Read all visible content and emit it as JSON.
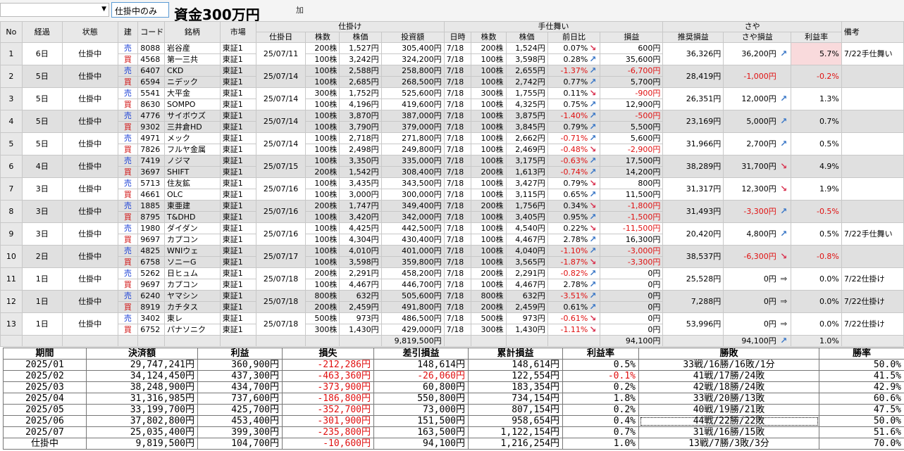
{
  "toolbar": {
    "filter_value": "仕掛中のみ",
    "capital_label": "資金300万円",
    "extra": "加"
  },
  "grid": {
    "header_groups": {
      "entry": "仕掛け",
      "exit": "手仕舞い",
      "spread": "さや",
      "note": "備考"
    },
    "headers": {
      "no": "No",
      "elapsed": "経過",
      "status": "状態",
      "side": "建",
      "code": "コード",
      "name": "銘柄",
      "market": "市場",
      "entry_date": "仕掛日",
      "entry_shares": "株数",
      "entry_price": "株価",
      "entry_amount": "投資額",
      "exit_date": "日時",
      "exit_shares": "株数",
      "exit_price": "株価",
      "exit_change": "前日比",
      "exit_pl": "損益",
      "rec_pl": "推奨損益",
      "spread_pl": "さや損益",
      "rate": "利益率"
    },
    "rows": [
      {
        "no": "1",
        "elapsed": "6日",
        "status": "仕掛中",
        "date": "25/07/11",
        "rec": "36,326円",
        "spread": "36,200円",
        "trend": "up",
        "rate": "5.7%",
        "note": "7/22手仕舞い",
        "pink": true,
        "legs": [
          {
            "side": "売",
            "code": "8088",
            "name": "岩谷産",
            "market": "東証1",
            "shares": "200株",
            "price": "1,527円",
            "amount": "305,400円",
            "xdate": "7/18",
            "xshares": "200株",
            "xprice": "1,524円",
            "chg": "0.07%",
            "chgdir": "down",
            "pl": "600円"
          },
          {
            "side": "買",
            "code": "4568",
            "name": "第一三共",
            "market": "東証1",
            "shares": "100株",
            "price": "3,242円",
            "amount": "324,200円",
            "xdate": "7/18",
            "xshares": "100株",
            "xprice": "3,598円",
            "chg": "0.28%",
            "chgdir": "up",
            "pl": "35,600円"
          }
        ]
      },
      {
        "no": "2",
        "elapsed": "5日",
        "status": "仕掛中",
        "date": "25/07/14",
        "rec": "28,419円",
        "spread": "-1,000円",
        "trend": "",
        "rate": "-0.2%",
        "note": "",
        "pink": false,
        "legs": [
          {
            "side": "売",
            "code": "6407",
            "name": "CKD",
            "market": "東証1",
            "shares": "100株",
            "price": "2,588円",
            "amount": "258,800円",
            "xdate": "7/18",
            "xshares": "100株",
            "xprice": "2,655円",
            "chg": "-1.37%",
            "chgdir": "up",
            "pl": "-6,700円"
          },
          {
            "side": "買",
            "code": "6594",
            "name": "ニデック",
            "market": "東証1",
            "shares": "100株",
            "price": "2,685円",
            "amount": "268,500円",
            "xdate": "7/18",
            "xshares": "100株",
            "xprice": "2,742円",
            "chg": "0.77%",
            "chgdir": "up",
            "pl": "5,700円"
          }
        ]
      },
      {
        "no": "3",
        "elapsed": "5日",
        "status": "仕掛中",
        "date": "25/07/14",
        "rec": "26,351円",
        "spread": "12,000円",
        "trend": "up",
        "rate": "1.3%",
        "note": "",
        "pink": false,
        "legs": [
          {
            "side": "売",
            "code": "5541",
            "name": "大平金",
            "market": "東証1",
            "shares": "300株",
            "price": "1,752円",
            "amount": "525,600円",
            "xdate": "7/18",
            "xshares": "300株",
            "xprice": "1,755円",
            "chg": "0.11%",
            "chgdir": "down",
            "pl": "-900円"
          },
          {
            "side": "買",
            "code": "8630",
            "name": "SOMPO",
            "market": "東証1",
            "shares": "100株",
            "price": "4,196円",
            "amount": "419,600円",
            "xdate": "7/18",
            "xshares": "100株",
            "xprice": "4,325円",
            "chg": "0.75%",
            "chgdir": "up",
            "pl": "12,900円"
          }
        ]
      },
      {
        "no": "4",
        "elapsed": "5日",
        "status": "仕掛中",
        "date": "25/07/14",
        "rec": "23,169円",
        "spread": "5,000円",
        "trend": "up",
        "rate": "0.7%",
        "note": "",
        "pink": false,
        "legs": [
          {
            "side": "売",
            "code": "4776",
            "name": "サイボウズ",
            "market": "東証1",
            "shares": "100株",
            "price": "3,870円",
            "amount": "387,000円",
            "xdate": "7/18",
            "xshares": "100株",
            "xprice": "3,875円",
            "chg": "-1.40%",
            "chgdir": "up",
            "pl": "-500円"
          },
          {
            "side": "買",
            "code": "9302",
            "name": "三井倉HD",
            "market": "東証1",
            "shares": "100株",
            "price": "3,790円",
            "amount": "379,000円",
            "xdate": "7/18",
            "xshares": "100株",
            "xprice": "3,845円",
            "chg": "0.79%",
            "chgdir": "up",
            "pl": "5,500円"
          }
        ]
      },
      {
        "no": "5",
        "elapsed": "5日",
        "status": "仕掛中",
        "date": "25/07/14",
        "rec": "31,966円",
        "spread": "2,700円",
        "trend": "up",
        "rate": "0.5%",
        "note": "",
        "pink": false,
        "legs": [
          {
            "side": "売",
            "code": "4971",
            "name": "メック",
            "market": "東証1",
            "shares": "100株",
            "price": "2,718円",
            "amount": "271,800円",
            "xdate": "7/18",
            "xshares": "100株",
            "xprice": "2,662円",
            "chg": "-0.71%",
            "chgdir": "up",
            "pl": "5,600円"
          },
          {
            "side": "買",
            "code": "7826",
            "name": "フルヤ金属",
            "market": "東証1",
            "shares": "100株",
            "price": "2,498円",
            "amount": "249,800円",
            "xdate": "7/18",
            "xshares": "100株",
            "xprice": "2,469円",
            "chg": "-0.48%",
            "chgdir": "down",
            "pl": "-2,900円"
          }
        ]
      },
      {
        "no": "6",
        "elapsed": "4日",
        "status": "仕掛中",
        "date": "25/07/15",
        "rec": "38,289円",
        "spread": "31,700円",
        "trend": "down",
        "rate": "4.9%",
        "note": "",
        "pink": false,
        "legs": [
          {
            "side": "売",
            "code": "7419",
            "name": "ノジマ",
            "market": "東証1",
            "shares": "100株",
            "price": "3,350円",
            "amount": "335,000円",
            "xdate": "7/18",
            "xshares": "100株",
            "xprice": "3,175円",
            "chg": "-0.63%",
            "chgdir": "up",
            "pl": "17,500円"
          },
          {
            "side": "買",
            "code": "3697",
            "name": "SHIFT",
            "market": "東証1",
            "shares": "200株",
            "price": "1,542円",
            "amount": "308,400円",
            "xdate": "7/18",
            "xshares": "200株",
            "xprice": "1,613円",
            "chg": "-0.74%",
            "chgdir": "up",
            "pl": "14,200円"
          }
        ]
      },
      {
        "no": "7",
        "elapsed": "3日",
        "status": "仕掛中",
        "date": "25/07/16",
        "rec": "31,317円",
        "spread": "12,300円",
        "trend": "down",
        "rate": "1.9%",
        "note": "",
        "pink": false,
        "legs": [
          {
            "side": "売",
            "code": "5713",
            "name": "住友鉱",
            "market": "東証1",
            "shares": "100株",
            "price": "3,435円",
            "amount": "343,500円",
            "xdate": "7/18",
            "xshares": "100株",
            "xprice": "3,427円",
            "chg": "0.79%",
            "chgdir": "down",
            "pl": "800円"
          },
          {
            "side": "買",
            "code": "4661",
            "name": "OLC",
            "market": "東証1",
            "shares": "100株",
            "price": "3,000円",
            "amount": "300,000円",
            "xdate": "7/18",
            "xshares": "100株",
            "xprice": "3,115円",
            "chg": "0.65%",
            "chgdir": "up",
            "pl": "11,500円"
          }
        ]
      },
      {
        "no": "8",
        "elapsed": "3日",
        "status": "仕掛中",
        "date": "25/07/16",
        "rec": "31,493円",
        "spread": "-3,300円",
        "trend": "up",
        "rate": "-0.5%",
        "note": "",
        "pink": false,
        "legs": [
          {
            "side": "売",
            "code": "1885",
            "name": "東亜建",
            "market": "東証1",
            "shares": "200株",
            "price": "1,747円",
            "amount": "349,400円",
            "xdate": "7/18",
            "xshares": "200株",
            "xprice": "1,756円",
            "chg": "0.34%",
            "chgdir": "down",
            "pl": "-1,800円"
          },
          {
            "side": "買",
            "code": "8795",
            "name": "T&DHD",
            "market": "東証1",
            "shares": "100株",
            "price": "3,420円",
            "amount": "342,000円",
            "xdate": "7/18",
            "xshares": "100株",
            "xprice": "3,405円",
            "chg": "0.95%",
            "chgdir": "up",
            "pl": "-1,500円"
          }
        ]
      },
      {
        "no": "9",
        "elapsed": "3日",
        "status": "仕掛中",
        "date": "25/07/16",
        "rec": "20,420円",
        "spread": "4,800円",
        "trend": "up",
        "rate": "0.5%",
        "note": "7/22手仕舞い",
        "pink": false,
        "legs": [
          {
            "side": "売",
            "code": "1980",
            "name": "ダイダン",
            "market": "東証1",
            "shares": "100株",
            "price": "4,425円",
            "amount": "442,500円",
            "xdate": "7/18",
            "xshares": "100株",
            "xprice": "4,540円",
            "chg": "0.22%",
            "chgdir": "down",
            "pl": "-11,500円"
          },
          {
            "side": "買",
            "code": "9697",
            "name": "カプコン",
            "market": "東証1",
            "shares": "100株",
            "price": "4,304円",
            "amount": "430,400円",
            "xdate": "7/18",
            "xshares": "100株",
            "xprice": "4,467円",
            "chg": "2.78%",
            "chgdir": "up",
            "pl": "16,300円"
          }
        ]
      },
      {
        "no": "10",
        "elapsed": "2日",
        "status": "仕掛中",
        "date": "25/07/17",
        "rec": "38,537円",
        "spread": "-6,300円",
        "trend": "down",
        "rate": "-0.8%",
        "note": "",
        "pink": false,
        "legs": [
          {
            "side": "売",
            "code": "4825",
            "name": "WNIウェ",
            "market": "東証1",
            "shares": "100株",
            "price": "4,010円",
            "amount": "401,000円",
            "xdate": "7/18",
            "xshares": "100株",
            "xprice": "4,040円",
            "chg": "-1.10%",
            "chgdir": "up",
            "pl": "-3,000円"
          },
          {
            "side": "買",
            "code": "6758",
            "name": "ソニーG",
            "market": "東証1",
            "shares": "100株",
            "price": "3,598円",
            "amount": "359,800円",
            "xdate": "7/18",
            "xshares": "100株",
            "xprice": "3,565円",
            "chg": "-1.87%",
            "chgdir": "down",
            "pl": "-3,300円"
          }
        ]
      },
      {
        "no": "11",
        "elapsed": "1日",
        "status": "仕掛中",
        "date": "25/07/18",
        "rec": "25,528円",
        "spread": "0円",
        "trend": "flat",
        "rate": "0.0%",
        "note": "7/22仕掛け",
        "pink": false,
        "legs": [
          {
            "side": "売",
            "code": "5262",
            "name": "日ヒュム",
            "market": "東証1",
            "shares": "200株",
            "price": "2,291円",
            "amount": "458,200円",
            "xdate": "7/18",
            "xshares": "200株",
            "xprice": "2,291円",
            "chg": "-0.82%",
            "chgdir": "up",
            "pl": "0円"
          },
          {
            "side": "買",
            "code": "9697",
            "name": "カプコン",
            "market": "東証1",
            "shares": "100株",
            "price": "4,467円",
            "amount": "446,700円",
            "xdate": "7/18",
            "xshares": "100株",
            "xprice": "4,467円",
            "chg": "2.78%",
            "chgdir": "up",
            "pl": "0円"
          }
        ]
      },
      {
        "no": "12",
        "elapsed": "1日",
        "status": "仕掛中",
        "date": "25/07/18",
        "rec": "7,288円",
        "spread": "0円",
        "trend": "flat",
        "rate": "0.0%",
        "note": "7/22仕掛け",
        "pink": false,
        "legs": [
          {
            "side": "売",
            "code": "6240",
            "name": "ヤマシン",
            "market": "東証1",
            "shares": "800株",
            "price": "632円",
            "amount": "505,600円",
            "xdate": "7/18",
            "xshares": "800株",
            "xprice": "632円",
            "chg": "-3.51%",
            "chgdir": "up",
            "pl": "0円"
          },
          {
            "side": "買",
            "code": "8919",
            "name": "カチタス",
            "market": "東証1",
            "shares": "200株",
            "price": "2,459円",
            "amount": "491,800円",
            "xdate": "7/18",
            "xshares": "200株",
            "xprice": "2,459円",
            "chg": "0.61%",
            "chgdir": "up",
            "pl": "0円"
          }
        ]
      },
      {
        "no": "13",
        "elapsed": "1日",
        "status": "仕掛中",
        "date": "25/07/18",
        "rec": "53,996円",
        "spread": "0円",
        "trend": "flat",
        "rate": "0.0%",
        "note": "7/22仕掛け",
        "pink": false,
        "legs": [
          {
            "side": "売",
            "code": "3402",
            "name": "東レ",
            "market": "東証1",
            "shares": "500株",
            "price": "973円",
            "amount": "486,500円",
            "xdate": "7/18",
            "xshares": "500株",
            "xprice": "973円",
            "chg": "-0.61%",
            "chgdir": "down",
            "pl": "0円"
          },
          {
            "side": "買",
            "code": "6752",
            "name": "パナソニク",
            "market": "東証1",
            "shares": "300株",
            "price": "1,430円",
            "amount": "429,000円",
            "xdate": "7/18",
            "xshares": "300株",
            "xprice": "1,430円",
            "chg": "-1.11%",
            "chgdir": "down",
            "pl": "0円"
          }
        ]
      }
    ],
    "totals": {
      "amount": "9,819,500円",
      "pl": "94,100円",
      "spread": "94,100円",
      "trend": "up",
      "rate": "1.0%"
    }
  },
  "summary": {
    "headers": [
      "期間",
      "決済額",
      "利益",
      "損失",
      "差引損益",
      "累計損益",
      "利益率",
      "勝敗",
      "勝率"
    ],
    "rows": [
      [
        "2025/01",
        "29,747,241円",
        "360,900円",
        "-212,286円",
        "148,614円",
        "148,614円",
        "0.5%",
        "33戦/16勝/16敗/1分",
        "50.0%"
      ],
      [
        "2025/02",
        "34,124,450円",
        "437,300円",
        "-463,360円",
        "-26,060円",
        "122,554円",
        "-0.1%",
        "41戦/17勝/24敗",
        "41.5%"
      ],
      [
        "2025/03",
        "38,248,900円",
        "434,700円",
        "-373,900円",
        "60,800円",
        "183,354円",
        "0.2%",
        "42戦/18勝/24敗",
        "42.9%"
      ],
      [
        "2025/04",
        "31,316,985円",
        "737,600円",
        "-186,800円",
        "550,800円",
        "734,154円",
        "1.8%",
        "33戦/20勝/13敗",
        "60.6%"
      ],
      [
        "2025/05",
        "33,199,700円",
        "425,700円",
        "-352,700円",
        "73,000円",
        "807,154円",
        "0.2%",
        "40戦/19勝/21敗",
        "47.5%"
      ],
      [
        "2025/06",
        "37,802,800円",
        "453,400円",
        "-301,900円",
        "151,500円",
        "958,654円",
        "0.4%",
        "44戦/22勝/22敗",
        "50.0%"
      ],
      [
        "2025/07",
        "25,035,400円",
        "399,300円",
        "-235,800円",
        "163,500円",
        "1,122,154円",
        "0.7%",
        "31戦/16勝/15敗",
        "51.6%"
      ],
      [
        "仕掛中",
        "9,819,500円",
        "104,700円",
        "-10,600円",
        "94,100円",
        "1,216,254円",
        "1.0%",
        "13戦/7勝/3敗/3分",
        "70.0%"
      ]
    ]
  }
}
